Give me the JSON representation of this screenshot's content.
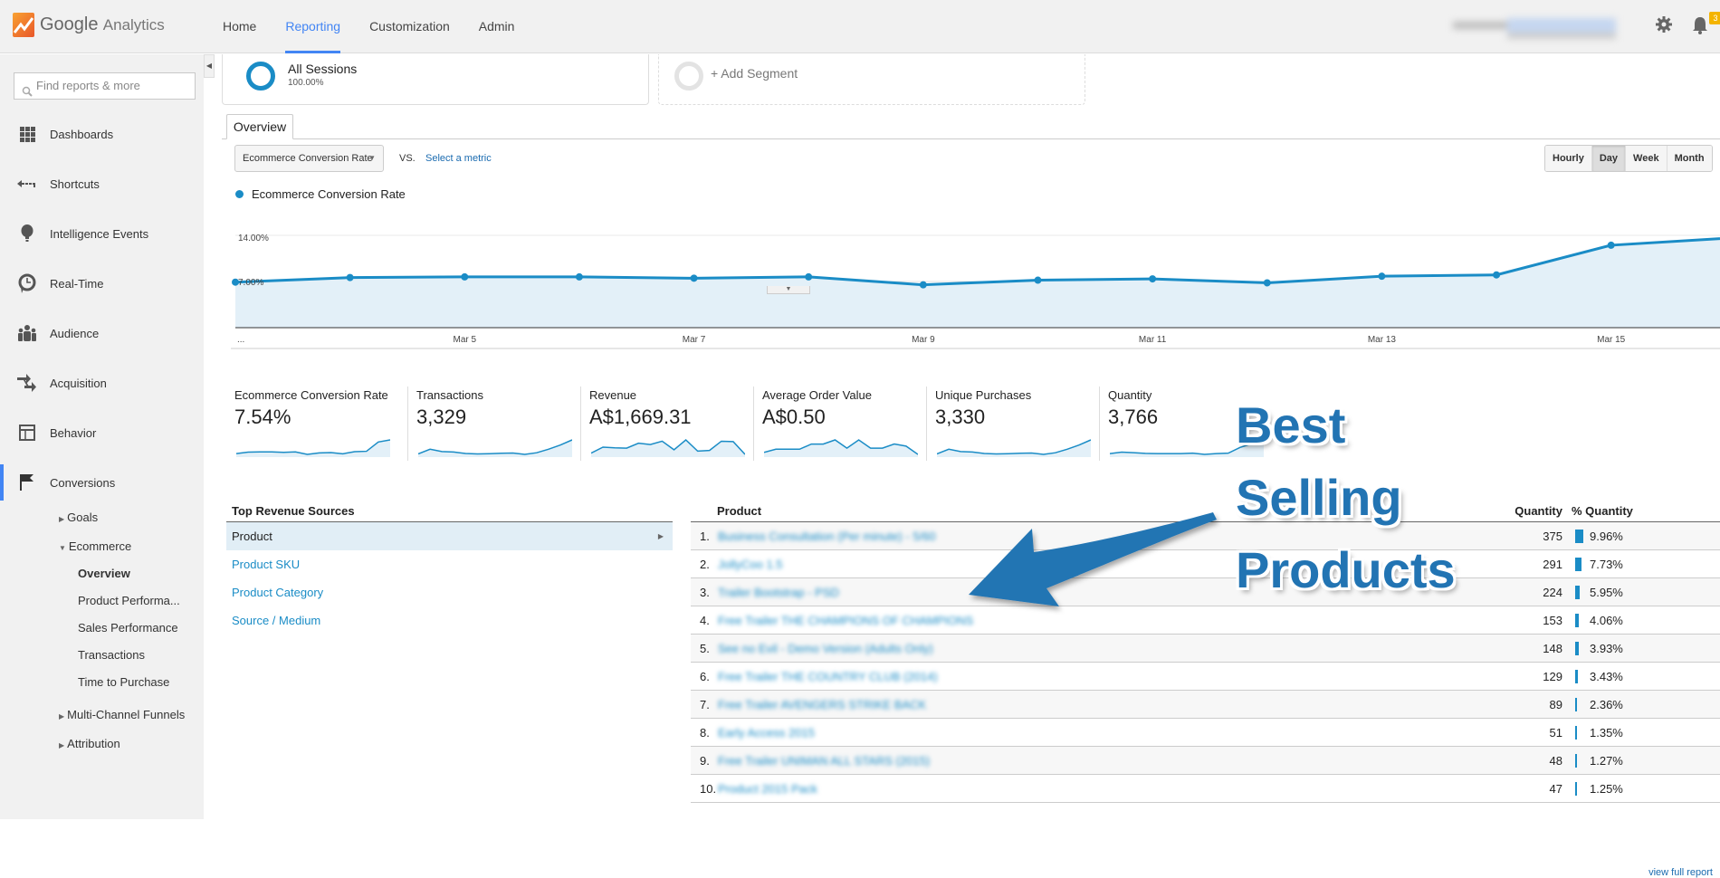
{
  "app": {
    "brand": "Google",
    "product": "Analytics"
  },
  "nav": {
    "items": [
      "Home",
      "Reporting",
      "Customization",
      "Admin"
    ],
    "active": "Reporting"
  },
  "header": {
    "notifications_count": "3",
    "account_name_blurred": true
  },
  "sidebar": {
    "search_placeholder": "Find reports & more",
    "items": [
      {
        "label": "Dashboards",
        "icon": "dashboards-icon"
      },
      {
        "label": "Shortcuts",
        "icon": "shortcuts-icon"
      },
      {
        "label": "Intelligence Events",
        "icon": "lightbulb-icon"
      },
      {
        "label": "Real-Time",
        "icon": "clock-icon"
      },
      {
        "label": "Audience",
        "icon": "people-icon"
      },
      {
        "label": "Acquisition",
        "icon": "arrows-icon"
      },
      {
        "label": "Behavior",
        "icon": "layout-icon"
      },
      {
        "label": "Conversions",
        "icon": "flag-icon"
      }
    ],
    "conversions_sub": {
      "goals": "Goals",
      "ecommerce": "Ecommerce",
      "ecommerce_children": [
        "Overview",
        "Product Performa...",
        "Sales Performance",
        "Transactions",
        "Time to Purchase"
      ],
      "multi_channel": "Multi-Channel Funnels",
      "attribution": "Attribution"
    }
  },
  "segments": {
    "active": {
      "name": "All Sessions",
      "pct": "100.00%"
    },
    "add_label": "+ Add Segment"
  },
  "tabs": {
    "overview": "Overview"
  },
  "controls": {
    "metric": "Ecommerce Conversion Rate",
    "vs": "VS.",
    "select_metric": "Select a metric",
    "periods": [
      "Hourly",
      "Day",
      "Week",
      "Month"
    ],
    "active_period": "Day"
  },
  "chart_data": {
    "type": "area",
    "title": "",
    "legend": [
      "Ecommerce Conversion Rate"
    ],
    "legend_position": "top-left",
    "series_color": "#1a8cc6",
    "x": [
      "Mar 3",
      "Mar 4",
      "Mar 5",
      "Mar 6",
      "Mar 7",
      "Mar 8",
      "Mar 9",
      "Mar 10",
      "Mar 11",
      "Mar 12",
      "Mar 13",
      "Mar 14",
      "Mar 15",
      "Mar 16"
    ],
    "x_tick_labels": [
      "...",
      "Mar 5",
      "Mar 7",
      "Mar 9",
      "Mar 11",
      "Mar 13",
      "Mar 15"
    ],
    "values": [
      6.9,
      7.6,
      7.7,
      7.7,
      7.5,
      7.7,
      6.5,
      7.2,
      7.4,
      6.8,
      7.8,
      8.0,
      12.5,
      13.5
    ],
    "ylim": [
      0,
      14
    ],
    "y_tick_labels": [
      "14.00%",
      "7.00%"
    ],
    "grid": true
  },
  "kpis": [
    {
      "name": "Ecommerce Conversion Rate",
      "value": "7.54%",
      "spark": [
        6.9,
        7.6,
        7.7,
        7.7,
        7.5,
        7.7,
        6.5,
        7.2,
        7.4,
        6.8,
        7.8,
        8.0,
        12.5,
        13.5
      ]
    },
    {
      "name": "Transactions",
      "value": "3,329",
      "spark": [
        230,
        250,
        240,
        238,
        232,
        230,
        231,
        233,
        234,
        228,
        235,
        250,
        268,
        290
      ]
    },
    {
      "name": "Revenue",
      "value": "A$1,669.31",
      "spark": [
        100,
        118,
        116,
        115,
        130,
        126,
        136,
        110,
        140,
        106,
        108,
        136,
        135,
        96
      ]
    },
    {
      "name": "Average Order Value",
      "value": "A$0.50",
      "spark": [
        0.44,
        0.47,
        0.47,
        0.47,
        0.52,
        0.52,
        0.56,
        0.48,
        0.56,
        0.48,
        0.48,
        0.52,
        0.5,
        0.42
      ]
    },
    {
      "name": "Unique Purchases",
      "value": "3,330",
      "spark": [
        230,
        250,
        240,
        238,
        232,
        230,
        231,
        233,
        234,
        228,
        235,
        250,
        268,
        290
      ]
    },
    {
      "name": "Quantity",
      "value": "3,766",
      "spark": [
        250,
        262,
        258,
        252,
        250,
        250,
        250,
        254,
        244,
        250,
        254,
        300,
        330,
        360
      ]
    }
  ],
  "annotation": {
    "lines": [
      "Best",
      "Selling",
      "Products"
    ],
    "color": "#2274b3"
  },
  "top_revenue_sources": {
    "title": "Top Revenue Sources",
    "items": [
      "Product",
      "Product SKU",
      "Product Category",
      "Source / Medium"
    ],
    "active": "Product"
  },
  "product_table": {
    "columns": [
      "Product",
      "Quantity",
      "% Quantity"
    ],
    "rows": [
      {
        "idx": "1.",
        "name": "Business Consultation (Per minute) - 5/60",
        "qty": "375",
        "pct": "9.96%",
        "pct_value": 9.96
      },
      {
        "idx": "2.",
        "name": "JollyCoo 1.5",
        "qty": "291",
        "pct": "7.73%",
        "pct_value": 7.73
      },
      {
        "idx": "3.",
        "name": "Trailer Bootstrap - PSD",
        "qty": "224",
        "pct": "5.95%",
        "pct_value": 5.95
      },
      {
        "idx": "4.",
        "name": "Free Trailer THE CHAMPIONS OF CHAMPIONS",
        "qty": "153",
        "pct": "4.06%",
        "pct_value": 4.06
      },
      {
        "idx": "5.",
        "name": "See no Evil - Demo Version (Adults Only)",
        "qty": "148",
        "pct": "3.93%",
        "pct_value": 3.93
      },
      {
        "idx": "6.",
        "name": "Free Trailer THE COUNTRY CLUB (2014)",
        "qty": "129",
        "pct": "3.43%",
        "pct_value": 3.43
      },
      {
        "idx": "7.",
        "name": "Free Trailer AVENGERS STRIKE BACK",
        "qty": "89",
        "pct": "2.36%",
        "pct_value": 2.36
      },
      {
        "idx": "8.",
        "name": "Early Access 2015",
        "qty": "51",
        "pct": "1.35%",
        "pct_value": 1.35
      },
      {
        "idx": "9.",
        "name": "Free Trailer UNIMAN ALL STARS (2015)",
        "qty": "48",
        "pct": "1.27%",
        "pct_value": 1.27
      },
      {
        "idx": "10.",
        "name": "Product 2015 Pack",
        "qty": "47",
        "pct": "1.25%",
        "pct_value": 1.25
      }
    ],
    "view_full_report": "view full report"
  }
}
